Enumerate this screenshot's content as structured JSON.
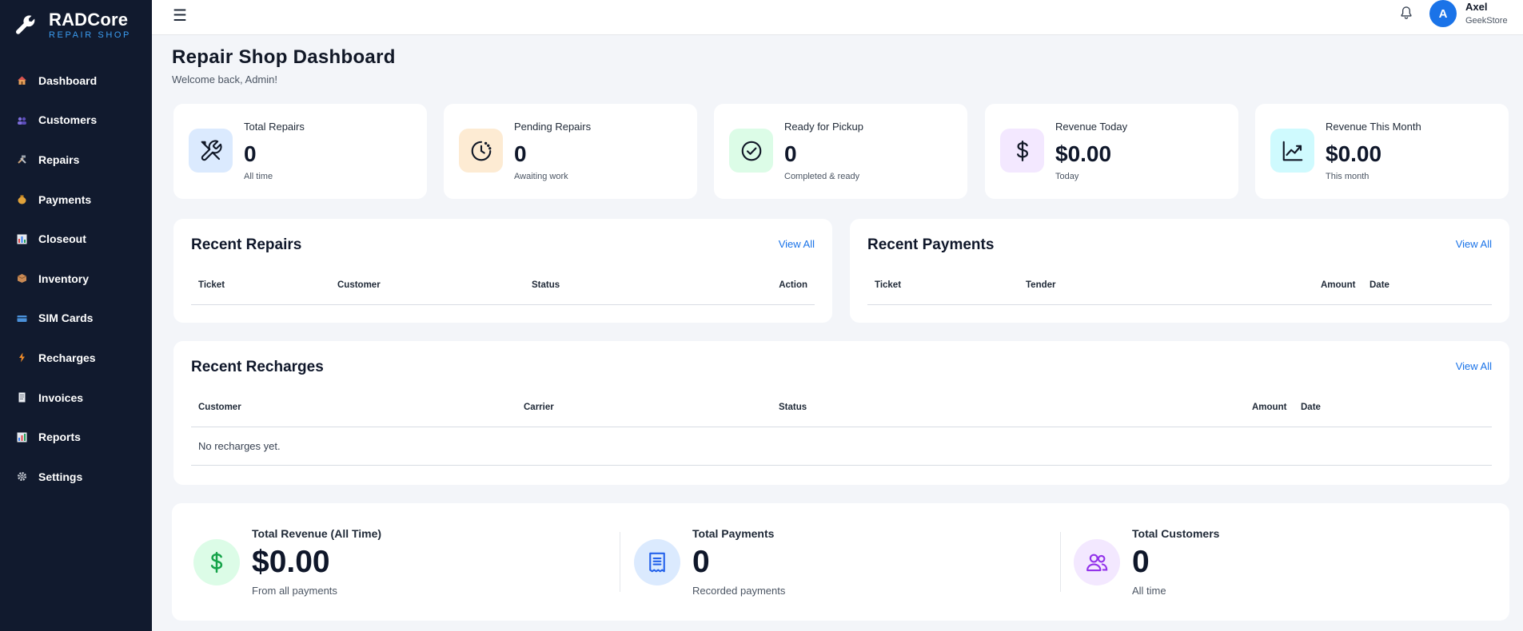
{
  "brand": {
    "name": "RADCore",
    "subtitle": "REPAIR SHOP"
  },
  "sidebar": {
    "items": [
      {
        "label": "Dashboard",
        "icon": "house-icon"
      },
      {
        "label": "Customers",
        "icon": "people-icon"
      },
      {
        "label": "Repairs",
        "icon": "hammer-wrench-icon"
      },
      {
        "label": "Payments",
        "icon": "money-bag-icon"
      },
      {
        "label": "Closeout",
        "icon": "bar-chart-icon"
      },
      {
        "label": "Inventory",
        "icon": "package-icon"
      },
      {
        "label": "SIM Cards",
        "icon": "card-icon"
      },
      {
        "label": "Recharges",
        "icon": "lightning-icon"
      },
      {
        "label": "Invoices",
        "icon": "receipt-icon"
      },
      {
        "label": "Reports",
        "icon": "chart-icon"
      },
      {
        "label": "Settings",
        "icon": "gear-icon"
      }
    ]
  },
  "topbar": {
    "menu_icon": "☰",
    "avatar_letter": "A",
    "user_name": "Axel",
    "user_store": "GeekStore"
  },
  "page": {
    "title": "Repair Shop Dashboard",
    "subtitle": "Welcome back, Admin!"
  },
  "stats": [
    {
      "label": "Total Repairs",
      "value": "0",
      "note": "All time",
      "icon": "tools-icon",
      "color": "#dbeafe"
    },
    {
      "label": "Pending Repairs",
      "value": "0",
      "note": "Awaiting work",
      "icon": "clock-icon",
      "color": "#fdebd3"
    },
    {
      "label": "Ready for Pickup",
      "value": "0",
      "note": "Completed & ready",
      "icon": "check-circle-icon",
      "color": "#dcfce7"
    },
    {
      "label": "Revenue Today",
      "value": "$0.00",
      "note": "Today",
      "icon": "dollar-icon",
      "color": "#f3e8ff"
    },
    {
      "label": "Revenue This Month",
      "value": "$0.00",
      "note": "This month",
      "icon": "trend-up-icon",
      "color": "#cffafe"
    }
  ],
  "recent_repairs": {
    "title": "Recent Repairs",
    "view_all": "View All",
    "columns": [
      "Ticket",
      "Customer",
      "Status",
      "Action"
    ]
  },
  "recent_payments": {
    "title": "Recent Payments",
    "view_all": "View All",
    "columns": [
      "Ticket",
      "Tender",
      "Amount",
      "Date"
    ]
  },
  "recent_recharges": {
    "title": "Recent Recharges",
    "view_all": "View All",
    "columns": [
      "Customer",
      "Carrier",
      "Status",
      "Amount",
      "Date"
    ],
    "empty_text": "No recharges yet."
  },
  "summary": [
    {
      "label": "Total Revenue (All Time)",
      "value": "$0.00",
      "note": "From all payments",
      "icon": "dollar-icon",
      "color": "#dcfce7"
    },
    {
      "label": "Total Payments",
      "value": "0",
      "note": "Recorded payments",
      "icon": "receipt-icon",
      "color": "#dbeafe"
    },
    {
      "label": "Total Customers",
      "value": "0",
      "note": "All time",
      "icon": "users-icon",
      "color": "#f3e8ff"
    }
  ]
}
